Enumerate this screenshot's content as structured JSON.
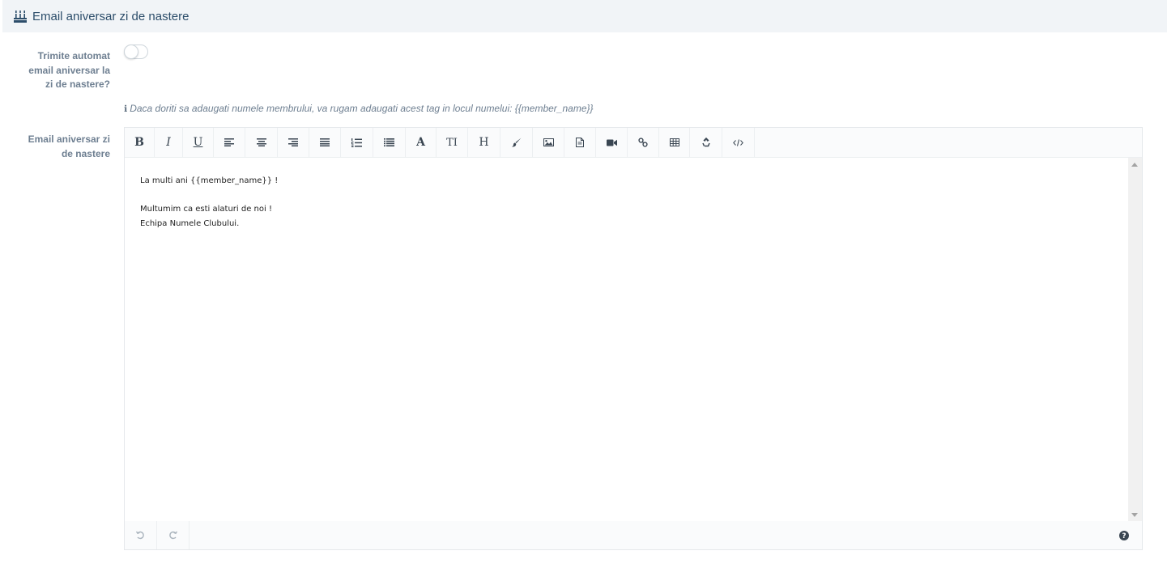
{
  "section": {
    "title": "Email aniversar zi de nastere",
    "icon": "birthday-cake-icon"
  },
  "auto_send": {
    "label_lines": [
      "Trimite automat",
      "email aniversar la",
      "zi de nastere?"
    ],
    "enabled": false
  },
  "hint": {
    "icon": "info-icon",
    "text": "Daca doriti sa adaugati numele membrului, va rugam adaugati acest tag in locul numelui: {{member_name}}"
  },
  "email_field": {
    "label_lines": [
      "Email aniversar zi",
      "de nastere"
    ]
  },
  "toolbar": {
    "buttons": [
      {
        "name": "bold",
        "icon": "bold-icon",
        "glyph": "B"
      },
      {
        "name": "italic",
        "icon": "italic-icon",
        "glyph": "I"
      },
      {
        "name": "underline",
        "icon": "underline-icon",
        "glyph": "U"
      },
      {
        "name": "align-left",
        "icon": "align-left-icon"
      },
      {
        "name": "align-center",
        "icon": "align-center-icon"
      },
      {
        "name": "align-right",
        "icon": "align-right-icon"
      },
      {
        "name": "align-justify",
        "icon": "align-justify-icon"
      },
      {
        "name": "ordered-list",
        "icon": "ordered-list-icon"
      },
      {
        "name": "unordered-list",
        "icon": "unordered-list-icon"
      },
      {
        "name": "font-color",
        "icon": "font-color-icon",
        "glyph": "A"
      },
      {
        "name": "font-size",
        "icon": "font-size-icon",
        "glyph": "TI"
      },
      {
        "name": "heading",
        "icon": "heading-icon",
        "glyph": "H"
      },
      {
        "name": "paint",
        "icon": "paint-brush-icon"
      },
      {
        "name": "image",
        "icon": "image-icon"
      },
      {
        "name": "file",
        "icon": "file-icon"
      },
      {
        "name": "video",
        "icon": "video-camera-icon"
      },
      {
        "name": "link",
        "icon": "link-icon"
      },
      {
        "name": "table",
        "icon": "table-icon"
      },
      {
        "name": "clear-format",
        "icon": "recycle-icon"
      },
      {
        "name": "code-view",
        "icon": "code-icon"
      }
    ]
  },
  "content": {
    "lines": [
      "La multi ani {{member_name}} !",
      "",
      "Multumim ca esti alaturi de noi !",
      "Echipa Numele Clubului."
    ]
  },
  "footer": {
    "undo_icon": "undo-icon",
    "redo_icon": "redo-icon",
    "help_icon": "question-circle-icon"
  }
}
